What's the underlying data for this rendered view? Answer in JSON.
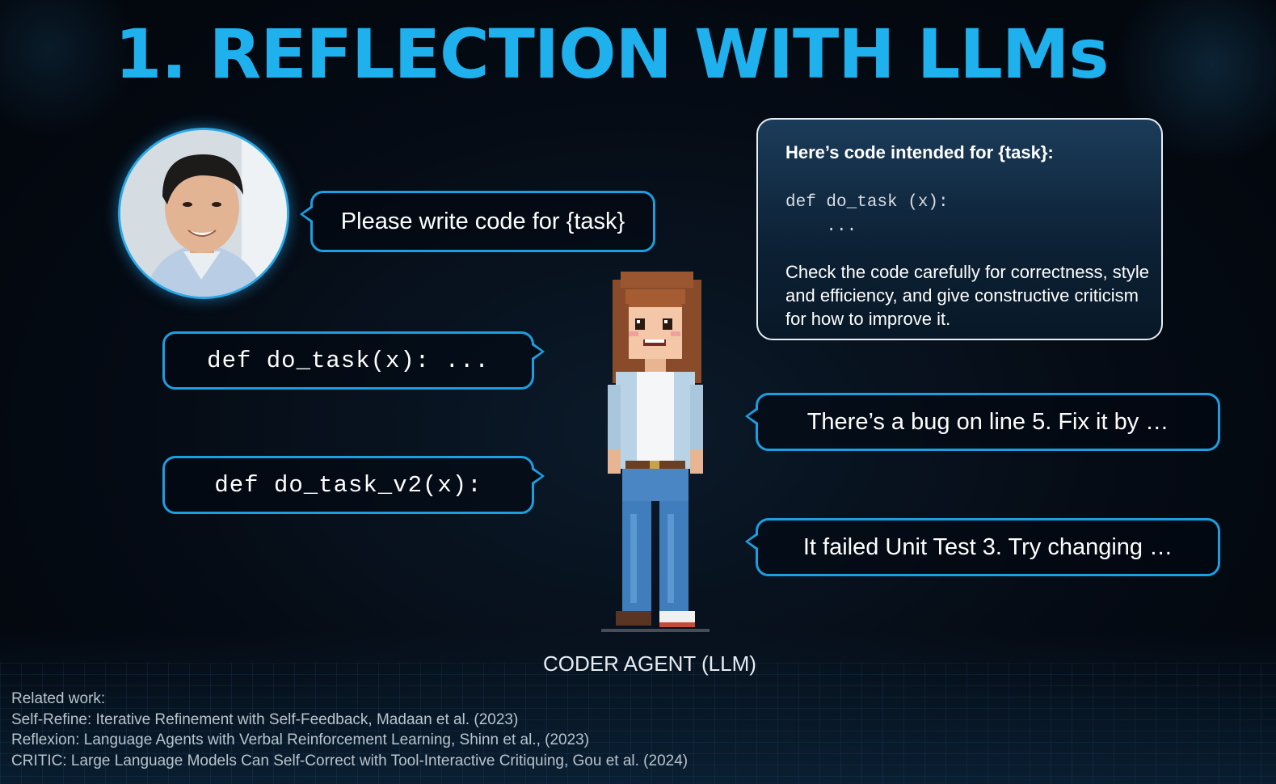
{
  "title": "1. REFLECTION WITH LLMs",
  "prompt_bubble": "Please write code for {task}",
  "code_v1": "def do_task(x): ...",
  "code_v2": "def do_task_v2(x):",
  "review": {
    "heading": "Here’s code intended for {task}:",
    "code_line1": "def do_task (x):",
    "code_line2": "    ...",
    "body": "Check the code carefully for correctness, style and efficiency, and give constructive criticism for how to improve it."
  },
  "feedback_bug": "There’s a bug on line 5. Fix it by …",
  "feedback_test": "It failed Unit Test 3. Try changing …",
  "agent_label": "CODER AGENT (LLM)",
  "related": {
    "heading": "Related work:",
    "items": [
      "Self-Refine: Iterative Refinement with Self-Feedback, Madaan et al. (2023)",
      "Reflexion: Language Agents with Verbal Reinforcement Learning, Shinn et al., (2023)",
      "CRITIC: Large Language Models Can Self-Correct with Tool-Interactive Critiquing, Gou et al. (2024)"
    ]
  },
  "colors": {
    "accent": "#1fb0ee",
    "bubble_border": "#1b9fe0",
    "background": "#050b14"
  },
  "icons": {
    "user_avatar": "person-photo",
    "agent": "pixel-character"
  }
}
